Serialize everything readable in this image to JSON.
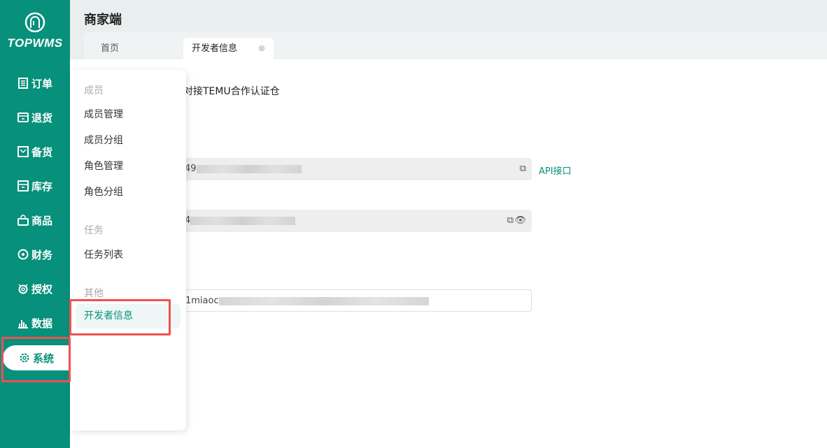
{
  "brand": {
    "name": "TOPWMS"
  },
  "header": {
    "title": "商家端"
  },
  "tabs": [
    {
      "label": "首页"
    },
    {
      "label": "开发者信息",
      "close": "⊗"
    }
  ],
  "sidebar": {
    "items": [
      {
        "label": "订单",
        "icon": "order-icon"
      },
      {
        "label": "退货",
        "icon": "return-icon"
      },
      {
        "label": "备货",
        "icon": "stock-icon"
      },
      {
        "label": "库存",
        "icon": "inventory-icon"
      },
      {
        "label": "商品",
        "icon": "goods-icon"
      },
      {
        "label": "财务",
        "icon": "finance-icon"
      },
      {
        "label": "授权",
        "icon": "auth-icon"
      },
      {
        "label": "数据",
        "icon": "data-icon"
      },
      {
        "label": "系统",
        "icon": "gear-icon",
        "active": true
      }
    ]
  },
  "flyout": {
    "groups": [
      {
        "title": "成员",
        "items": [
          "成员管理",
          "成员分组",
          "角色管理",
          "角色分组"
        ]
      },
      {
        "title": "任务",
        "items": [
          "任务列表"
        ]
      },
      {
        "title": "其他",
        "items": [
          "开发者信息"
        ]
      }
    ]
  },
  "content": {
    "title": "对接TEMU合作认证仓",
    "field1_prefix": "49",
    "field2_prefix": "4",
    "field3_prefix": "1miaoc",
    "api_link": "API接口"
  },
  "colors": {
    "brand": "#07907b",
    "highlight": "#f05050"
  }
}
